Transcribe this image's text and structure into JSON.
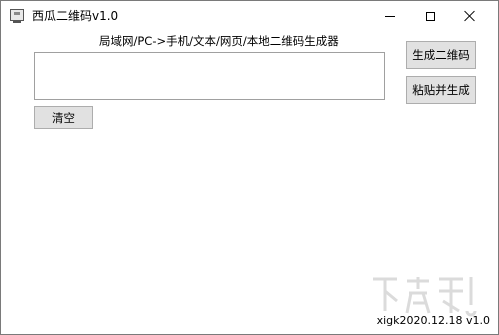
{
  "window": {
    "title": "西瓜二维码v1.0",
    "controls": {
      "minimize": "minimize-icon",
      "maximize": "maximize-icon",
      "close": "close-icon"
    }
  },
  "main": {
    "heading": "局域网/PC->手机/文本/网页/本地二维码生成器",
    "input_value": "",
    "input_placeholder": "",
    "generate_label": "生成二维码",
    "paste_generate_label": "粘贴并生成",
    "clear_label": "清空"
  },
  "footer": {
    "version": "xigk2020.12.18 v1.0"
  },
  "colors": {
    "window_bg": "#ffffff",
    "button_bg": "#e1e1e1",
    "button_border": "#adadad",
    "input_border": "#a0a0a0"
  }
}
